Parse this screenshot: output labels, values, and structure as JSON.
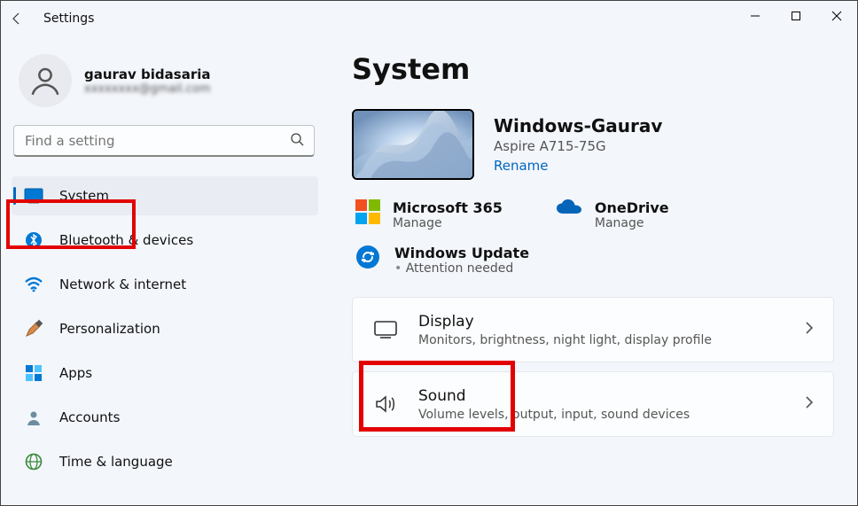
{
  "window": {
    "title": "Settings"
  },
  "profile": {
    "name": "gaurav bidasaria",
    "email": "@gmail.com"
  },
  "search": {
    "placeholder": "Find a setting"
  },
  "sidebar": {
    "items": [
      {
        "label": "System"
      },
      {
        "label": "Bluetooth & devices"
      },
      {
        "label": "Network & internet"
      },
      {
        "label": "Personalization"
      },
      {
        "label": "Apps"
      },
      {
        "label": "Accounts"
      },
      {
        "label": "Time & language"
      }
    ]
  },
  "page": {
    "title": "System"
  },
  "device": {
    "name": "Windows-Gaurav",
    "model": "Aspire A715-75G",
    "rename": "Rename"
  },
  "services": {
    "m365": {
      "title": "Microsoft 365",
      "sub": "Manage"
    },
    "onedrive": {
      "title": "OneDrive",
      "sub": "Manage"
    }
  },
  "update": {
    "title": "Windows Update",
    "sub": "Attention needed"
  },
  "cards": [
    {
      "title": "Display",
      "sub": "Monitors, brightness, night light, display profile"
    },
    {
      "title": "Sound",
      "sub": "Volume levels, output, input, sound devices"
    }
  ]
}
